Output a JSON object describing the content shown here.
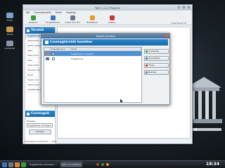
{
  "window": {
    "title": "Yast 1.3.2 (fispiro)"
  },
  "menubar": {
    "items": [
      "Fájl",
      "Csomagkezelés",
      "Kerés",
      "Segítség"
    ]
  },
  "toolbar": {
    "items": [
      {
        "label": "Alkalmaz",
        "color": "#3a9a3a"
      },
      {
        "label": "Szolgáltatások",
        "color": "#3f72b6"
      },
      {
        "label": "Install from file",
        "color": "#6b7785"
      },
      {
        "label": "Beállítások",
        "color": "#e0a02a"
      },
      {
        "label": "Kilépés",
        "color": "#c8392f"
      }
    ]
  },
  "right_info": "Lekérdezés 58",
  "sidebar": {
    "header": "Tárolók",
    "items": [
      "Fuggetlenek csomagok",
      "Alkalmazás alkalmazásai",
      "python-plugins",
      "apps",
      "base-rpms",
      "base",
      "base-extra",
      "drivers-core",
      "devel",
      "devel-core",
      "devel-extra",
      "identification"
    ],
    "selected_index": 0,
    "header2": "Csomagok",
    "kereses_label": "Keresés:",
    "kereses_value": "Fuggetlenek csomagok",
    "kereses_button": "Keresés"
  },
  "statusbar": "Csomagok kiválasztva  ...  7052",
  "dialog": {
    "title": "Tárolók kezelése",
    "header": "Csomagtárolók kezelése",
    "columns": [
      "",
      "Engedélyezve",
      "Tároló"
    ],
    "rows": [
      {
        "checked": true,
        "name": "Fuggetlenek csomagok",
        "selected": true
      },
      {
        "checked": false,
        "name": "Fuggetlenek",
        "selected": false
      }
    ],
    "buttons": [
      {
        "label": "Hozzáadás",
        "color": "#3a9a3a"
      },
      {
        "label": "Szerkesztés",
        "color": "#3f72b6"
      },
      {
        "label": "Törlés",
        "color": "#c8392f"
      },
      {
        "label": "Bezárás",
        "color": "#6b7785"
      }
    ]
  },
  "taskbar": {
    "tasks": [
      "Fuggetlenek csomagok ...",
      "Yast 1.3.2 (fispiro)"
    ],
    "clock": "18:34"
  },
  "desktop_icons": [
    "Trash",
    "Home",
    "Computer"
  ]
}
